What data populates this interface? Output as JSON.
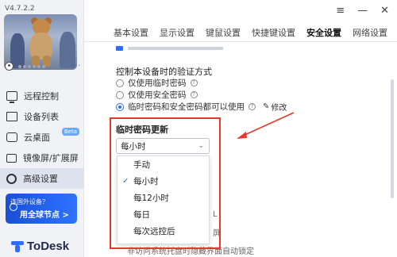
{
  "app": {
    "version": "V4.7.2.2",
    "logo_name": "ToDesk"
  },
  "sidebar": {
    "items": [
      {
        "label": "远程控制",
        "icon": "monitor-icon"
      },
      {
        "label": "设备列表",
        "icon": "device-list-icon"
      },
      {
        "label": "云桌面",
        "icon": "cloud-desktop-icon",
        "badge": "Beta"
      },
      {
        "label": "镜像屏/扩展屏",
        "icon": "mirror-screen-icon"
      },
      {
        "label": "高级设置",
        "icon": "gear-icon",
        "active": true
      }
    ],
    "promo": {
      "line1": "连国外设备？",
      "line2": "用全球节点 >"
    },
    "more": "···"
  },
  "titlebar": {
    "menu_icon": "≡",
    "minimize_icon": "—",
    "close_icon": "✕"
  },
  "tabs": [
    {
      "label": "基本设置"
    },
    {
      "label": "显示设置"
    },
    {
      "label": "键鼠设置"
    },
    {
      "label": "快捷键设置"
    },
    {
      "label": "安全设置",
      "active": true
    },
    {
      "label": "网络设置"
    }
  ],
  "security": {
    "auth_section_title": "控制本设备时的验证方式",
    "options": [
      {
        "label": "仅使用临时密码",
        "checked": false
      },
      {
        "label": "仅使用安全密码",
        "checked": false
      },
      {
        "label": "临时密码和安全密码都可以使用",
        "checked": true
      }
    ],
    "edit_label": "修改",
    "temp_pw_title": "临时密码更新",
    "selected_value": "每小时",
    "dropdown_options": [
      {
        "label": "手动",
        "selected": false
      },
      {
        "label": "每小时",
        "selected": true
      },
      {
        "label": "每12小时",
        "selected": false
      },
      {
        "label": "每日",
        "selected": false
      },
      {
        "label": "每次远控后",
        "selected": false
      }
    ],
    "partial_text_1": "屏",
    "partial_text_2": "非访问系统托盘时隐藏界面自动锁定"
  },
  "colors": {
    "accent": "#2f6cff",
    "highlight": "#e23b2b",
    "sidebar_bg": "#f0f2f6"
  }
}
